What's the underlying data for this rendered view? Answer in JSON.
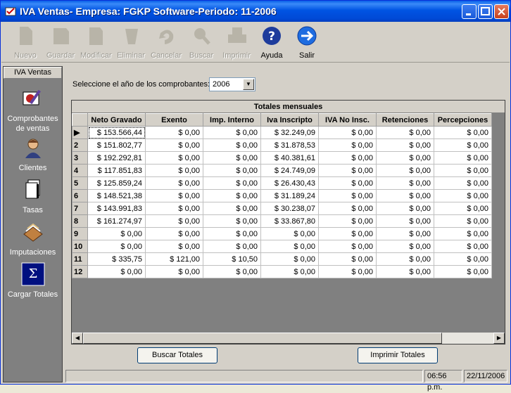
{
  "window": {
    "title": "IVA Ventas- Empresa: FGKP Software-Periodo: 11-2006"
  },
  "toolbar": {
    "buttons": [
      {
        "label": "Nuevo",
        "icon": "new-document-icon",
        "enabled": false
      },
      {
        "label": "Guardar",
        "icon": "save-icon",
        "enabled": false
      },
      {
        "label": "Modificar",
        "icon": "edit-icon",
        "enabled": false
      },
      {
        "label": "Eliminar",
        "icon": "delete-icon",
        "enabled": false
      },
      {
        "label": "Cancelar",
        "icon": "undo-icon",
        "enabled": false
      },
      {
        "label": "Buscar",
        "icon": "search-icon",
        "enabled": false
      },
      {
        "label": "Imprimir",
        "icon": "printer-icon",
        "enabled": false
      },
      {
        "label": "Ayuda",
        "icon": "help-icon",
        "enabled": true
      },
      {
        "label": "Salir",
        "icon": "exit-arrow-icon",
        "enabled": true
      }
    ]
  },
  "sidebar": {
    "header": "IVA Ventas",
    "items": [
      {
        "label": "Comprobantes de ventas",
        "icon": "vouchers-icon"
      },
      {
        "label": "Clientes",
        "icon": "person-icon"
      },
      {
        "label": "Tasas",
        "icon": "pages-icon"
      },
      {
        "label": "Imputaciones",
        "icon": "folders-icon"
      },
      {
        "label": "Cargar Totales",
        "icon": "sum-icon"
      }
    ]
  },
  "filter": {
    "label": "Seleccione el año de los comprobantes:",
    "year": "2006"
  },
  "grid": {
    "caption": "Totales mensuales",
    "columns": [
      "Neto Gravado",
      "Exento",
      "Imp. Interno",
      "Iva Inscripto",
      "IVA No Insc.",
      "Retenciones",
      "Percepciones"
    ],
    "rows": [
      {
        "n": "",
        "current": true,
        "cells": [
          "$ 153.566,44",
          "$ 0,00",
          "$ 0,00",
          "$ 32.249,09",
          "$ 0,00",
          "$ 0,00",
          "$ 0,00"
        ]
      },
      {
        "n": "2",
        "cells": [
          "$ 151.802,77",
          "$ 0,00",
          "$ 0,00",
          "$ 31.878,53",
          "$ 0,00",
          "$ 0,00",
          "$ 0,00"
        ]
      },
      {
        "n": "3",
        "cells": [
          "$ 192.292,81",
          "$ 0,00",
          "$ 0,00",
          "$ 40.381,61",
          "$ 0,00",
          "$ 0,00",
          "$ 0,00"
        ]
      },
      {
        "n": "4",
        "cells": [
          "$ 117.851,83",
          "$ 0,00",
          "$ 0,00",
          "$ 24.749,09",
          "$ 0,00",
          "$ 0,00",
          "$ 0,00"
        ]
      },
      {
        "n": "5",
        "cells": [
          "$ 125.859,24",
          "$ 0,00",
          "$ 0,00",
          "$ 26.430,43",
          "$ 0,00",
          "$ 0,00",
          "$ 0,00"
        ]
      },
      {
        "n": "6",
        "cells": [
          "$ 148.521,38",
          "$ 0,00",
          "$ 0,00",
          "$ 31.189,24",
          "$ 0,00",
          "$ 0,00",
          "$ 0,00"
        ]
      },
      {
        "n": "7",
        "cells": [
          "$ 143.991,83",
          "$ 0,00",
          "$ 0,00",
          "$ 30.238,07",
          "$ 0,00",
          "$ 0,00",
          "$ 0,00"
        ]
      },
      {
        "n": "8",
        "cells": [
          "$ 161.274,97",
          "$ 0,00",
          "$ 0,00",
          "$ 33.867,80",
          "$ 0,00",
          "$ 0,00",
          "$ 0,00"
        ]
      },
      {
        "n": "9",
        "cells": [
          "$ 0,00",
          "$ 0,00",
          "$ 0,00",
          "$ 0,00",
          "$ 0,00",
          "$ 0,00",
          "$ 0,00"
        ]
      },
      {
        "n": "10",
        "cells": [
          "$ 0,00",
          "$ 0,00",
          "$ 0,00",
          "$ 0,00",
          "$ 0,00",
          "$ 0,00",
          "$ 0,00"
        ]
      },
      {
        "n": "11",
        "cells": [
          "$ 335,75",
          "$ 121,00",
          "$ 10,50",
          "$ 0,00",
          "$ 0,00",
          "$ 0,00",
          "$ 0,00"
        ]
      },
      {
        "n": "12",
        "cells": [
          "$ 0,00",
          "$ 0,00",
          "$ 0,00",
          "$ 0,00",
          "$ 0,00",
          "$ 0,00",
          "$ 0,00"
        ]
      }
    ]
  },
  "actions": {
    "search_totals": "Buscar Totales",
    "print_totals": "Imprimir Totales"
  },
  "statusbar": {
    "time": "06:56 p.m.",
    "date": "22/11/2006"
  },
  "colors": {
    "title_blue": "#0054E3",
    "sidebar_gray": "#808080",
    "face": "#D4D0C8"
  }
}
